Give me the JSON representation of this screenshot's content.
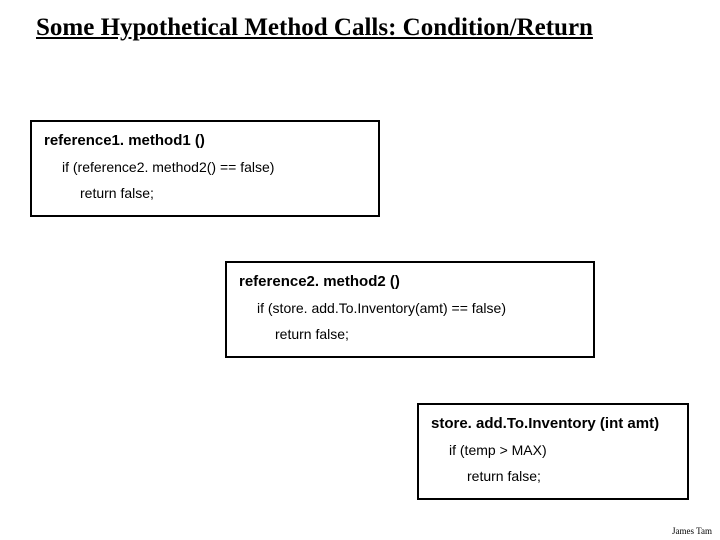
{
  "title": "Some Hypothetical Method Calls: Condition/Return",
  "box1": {
    "signature": "reference1. method1 ()",
    "condition": "if (reference2. method2() == false)",
    "ret": "return false;"
  },
  "box2": {
    "signature": "reference2. method2 ()",
    "condition": "if (store. add.To.Inventory(amt) == false)",
    "ret": "return false;"
  },
  "box3": {
    "signature": "store. add.To.Inventory (int amt)",
    "condition": "if (temp > MAX)",
    "ret": "return false;"
  },
  "footer": "James Tam"
}
